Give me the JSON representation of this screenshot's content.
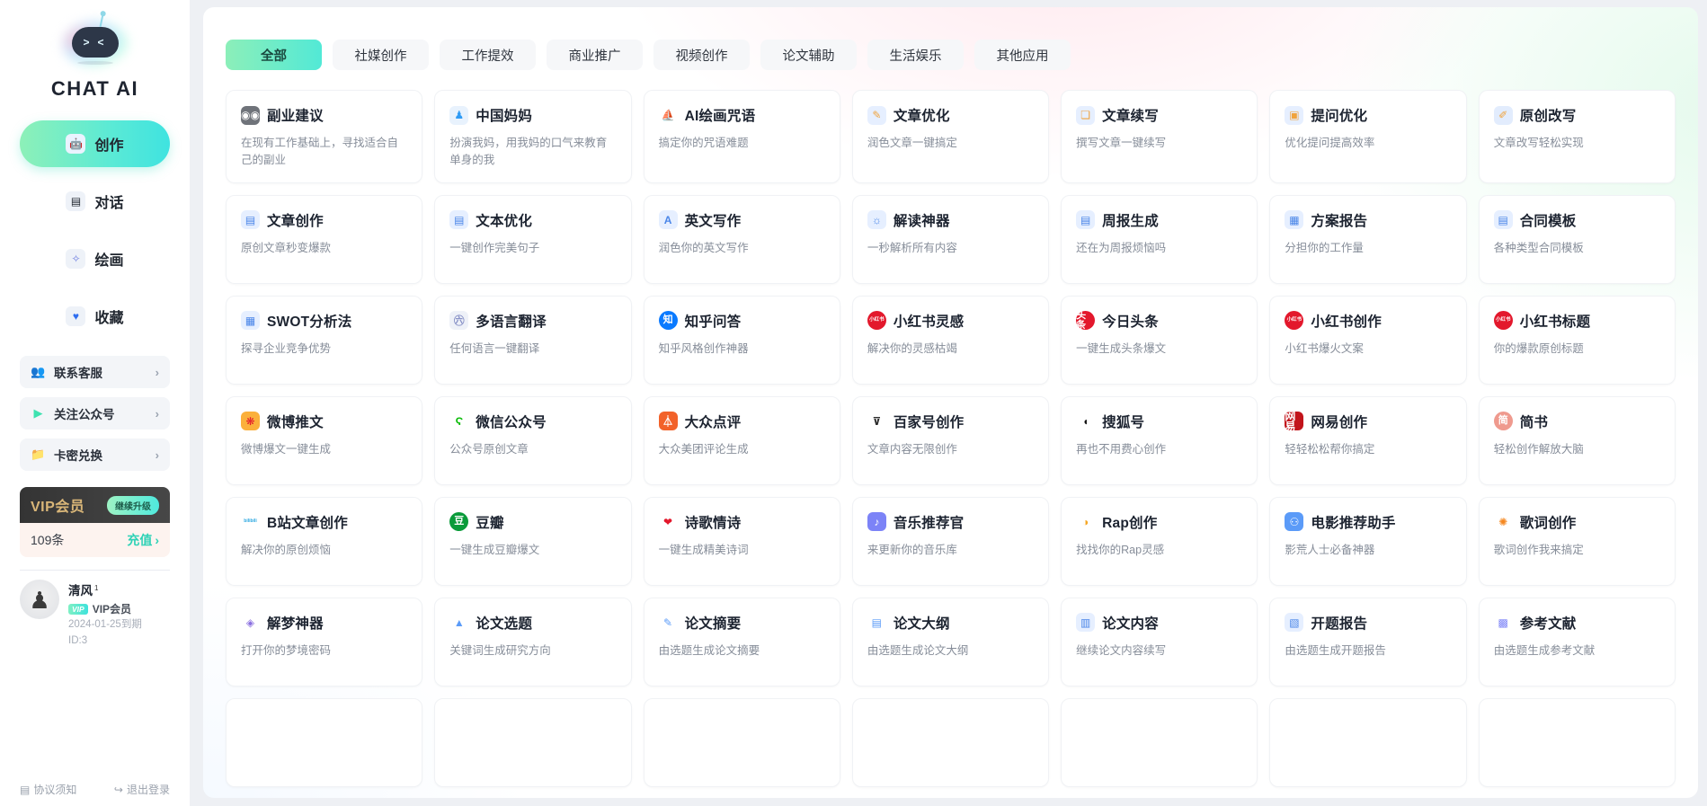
{
  "brand": {
    "name": "CHAT AI",
    "logo_icon": "robot-logo"
  },
  "sidebar": {
    "nav": [
      {
        "label": "创作",
        "icon": "robot-icon",
        "active": true
      },
      {
        "label": "对话",
        "icon": "chat-bubble-icon",
        "active": false
      },
      {
        "label": "绘画",
        "icon": "paintbrush-icon",
        "active": false
      },
      {
        "label": "收藏",
        "icon": "heart-icon",
        "active": false
      }
    ],
    "utils": [
      {
        "label": "联系客服",
        "icon": "customer-service-icon",
        "arrow": "›"
      },
      {
        "label": "关注公众号",
        "icon": "play-icon",
        "arrow": "›"
      },
      {
        "label": "卡密兑换",
        "icon": "folder-icon",
        "arrow": "›"
      }
    ],
    "vip": {
      "title": "VIP会员",
      "button": "继续升级"
    },
    "quota": {
      "count": "109条",
      "link": "充值",
      "arrow": "›"
    },
    "profile": {
      "name": "清风",
      "level": "1",
      "badge": "VIP",
      "member_label": "VIP会员",
      "expiry": "2024-01-25到期",
      "id": "ID:3",
      "avatar_icon": "user-avatar"
    },
    "footer": {
      "agreement": "协议须知",
      "agreement_icon": "document-icon",
      "logout": "退出登录",
      "logout_icon": "logout-icon"
    }
  },
  "tabs": [
    {
      "label": "全部",
      "active": true
    },
    {
      "label": "社媒创作",
      "active": false
    },
    {
      "label": "工作提效",
      "active": false
    },
    {
      "label": "商业推广",
      "active": false
    },
    {
      "label": "视频创作",
      "active": false
    },
    {
      "label": "论文辅助",
      "active": false
    },
    {
      "label": "生活娱乐",
      "active": false
    },
    {
      "label": "其他应用",
      "active": false
    }
  ],
  "cards": [
    {
      "title": "副业建议",
      "desc": "在现有工作基础上，寻找适合自己的副业",
      "icon": "panda-icon",
      "glyph": "◉◉",
      "bg": "#6f737a",
      "fg": "#ffffff"
    },
    {
      "title": "中国妈妈",
      "desc": "扮演我妈，用我妈的口气来教育单身的我",
      "icon": "person-blue-icon",
      "glyph": "♟",
      "bg": "#e8f2fd",
      "fg": "#2f9bf5"
    },
    {
      "title": "AI绘画咒语",
      "desc": "搞定你的咒语难题",
      "icon": "sailboat-icon",
      "glyph": "⛵",
      "bg": "#ffffff",
      "fg": "#5b6370"
    },
    {
      "title": "文章优化",
      "desc": "润色文章一键搞定",
      "icon": "pencil-doc-icon",
      "glyph": "✎",
      "bg": "#e6efff",
      "fg": "#f0a33c"
    },
    {
      "title": "文章续写",
      "desc": "撰写文章一键续写",
      "icon": "doc-check-icon",
      "glyph": "❏",
      "bg": "#e6efff",
      "fg": "#f0a33c"
    },
    {
      "title": "提问优化",
      "desc": "优化提问提高效率",
      "icon": "doc-blue-icon",
      "glyph": "▣",
      "bg": "#e6efff",
      "fg": "#f0a33c"
    },
    {
      "title": "原创改写",
      "desc": "文章改写轻松实现",
      "icon": "rewrite-icon",
      "glyph": "✐",
      "bg": "#e2ecfd",
      "fg": "#f0a33c"
    },
    {
      "title": "文章创作",
      "desc": "原创文章秒变爆款",
      "icon": "doc-edit-icon",
      "glyph": "▤",
      "bg": "#e6efff",
      "fg": "#4a86e8"
    },
    {
      "title": "文本优化",
      "desc": "一键创作完美句子",
      "icon": "doc-pen-icon",
      "glyph": "▤",
      "bg": "#e6efff",
      "fg": "#4a86e8"
    },
    {
      "title": "英文写作",
      "desc": "润色你的英文写作",
      "icon": "letter-a-icon",
      "glyph": "A",
      "bg": "#e6efff",
      "fg": "#4a86e8"
    },
    {
      "title": "解读神器",
      "desc": "一秒解析所有内容",
      "icon": "lamp-icon",
      "glyph": "☼",
      "bg": "#e6efff",
      "fg": "#4a86e8"
    },
    {
      "title": "周报生成",
      "desc": "还在为周报烦恼吗",
      "icon": "report-icon",
      "glyph": "▤",
      "bg": "#e6efff",
      "fg": "#4a86e8"
    },
    {
      "title": "方案报告",
      "desc": "分担你的工作量",
      "icon": "presentation-icon",
      "glyph": "▦",
      "bg": "#e6efff",
      "fg": "#4a86e8"
    },
    {
      "title": "合同模板",
      "desc": "各种类型合同模板",
      "icon": "contract-icon",
      "glyph": "▤",
      "bg": "#e6efff",
      "fg": "#4a86e8"
    },
    {
      "title": "SWOT分析法",
      "desc": "探寻企业竞争优势",
      "icon": "swot-icon",
      "glyph": "▦",
      "bg": "#e6efff",
      "fg": "#4a86e8"
    },
    {
      "title": "多语言翻译",
      "desc": "任何语言一键翻译",
      "icon": "translate-icon",
      "glyph": "㊅",
      "bg": "#eef1f8",
      "fg": "#8a93c8"
    },
    {
      "title": "知乎问答",
      "desc": "知乎风格创作神器",
      "icon": "zhihu-icon",
      "glyph": "知",
      "bg": "#0a7aff",
      "fg": "#ffffff"
    },
    {
      "title": "小红书灵感",
      "desc": "解决你的灵感枯竭",
      "icon": "xiaohongshu-icon",
      "glyph": "小红书",
      "bg": "#e3182c",
      "fg": "#ffffff"
    },
    {
      "title": "今日头条",
      "desc": "一键生成头条爆文",
      "icon": "toutiao-icon",
      "glyph": "头条",
      "bg": "#e3182c",
      "fg": "#ffffff"
    },
    {
      "title": "小红书创作",
      "desc": "小红书爆火文案",
      "icon": "xiaohongshu-icon",
      "glyph": "小红书",
      "bg": "#e3182c",
      "fg": "#ffffff"
    },
    {
      "title": "小红书标题",
      "desc": "你的爆款原创标题",
      "icon": "xiaohongshu-icon",
      "glyph": "小红书",
      "bg": "#e3182c",
      "fg": "#ffffff"
    },
    {
      "title": "微博推文",
      "desc": "微博爆文一键生成",
      "icon": "weibo-icon",
      "glyph": "❋",
      "bg": "#fbb03b",
      "fg": "#e3182c"
    },
    {
      "title": "微信公众号",
      "desc": "公众号原创文章",
      "icon": "wechat-icon",
      "glyph": "Ϛ",
      "bg": "#ffffff",
      "fg": "#09bb07"
    },
    {
      "title": "大众点评",
      "desc": "大众美团评论生成",
      "icon": "dianping-icon",
      "glyph": "⏃",
      "bg": "#f2622a",
      "fg": "#ffffff"
    },
    {
      "title": "百家号创作",
      "desc": "文章内容无限创作",
      "icon": "baijiahao-icon",
      "glyph": "⊽",
      "bg": "#ffffff",
      "fg": "#2b2b2b"
    },
    {
      "title": "搜狐号",
      "desc": "再也不用费心创作",
      "icon": "sohu-icon",
      "glyph": "◖",
      "bg": "#ffffff",
      "fg": "#111111"
    },
    {
      "title": "网易创作",
      "desc": "轻轻松松帮你搞定",
      "icon": "netease-icon",
      "glyph": "网易",
      "bg": "#c2141b",
      "fg": "#ffffff"
    },
    {
      "title": "简书",
      "desc": "轻松创作解放大脑",
      "icon": "jianshu-icon",
      "glyph": "简",
      "bg": "#ef9a8e",
      "fg": "#ffffff"
    },
    {
      "title": "B站文章创作",
      "desc": "解决你的原创烦恼",
      "icon": "bilibili-icon",
      "glyph": "bilibili",
      "bg": "#ffffff",
      "fg": "#2aa7e0"
    },
    {
      "title": "豆瓣",
      "desc": "一键生成豆瓣爆文",
      "icon": "douban-icon",
      "glyph": "豆",
      "bg": "#0a9b3a",
      "fg": "#ffffff"
    },
    {
      "title": "诗歌情诗",
      "desc": "一键生成精美诗词",
      "icon": "heart-red-icon",
      "glyph": "❤",
      "bg": "#ffffff",
      "fg": "#e3182c"
    },
    {
      "title": "音乐推荐官",
      "desc": "来更新你的音乐库",
      "icon": "music-icon",
      "glyph": "♪",
      "bg": "#7c83f7",
      "fg": "#ffffff"
    },
    {
      "title": "Rap创作",
      "desc": "找找你的Rap灵感",
      "icon": "megaphone-icon",
      "glyph": "◑",
      "bg": "#ffffff",
      "fg": "#f5a623"
    },
    {
      "title": "电影推荐助手",
      "desc": "影荒人士必备神器",
      "icon": "film-reel-icon",
      "glyph": "⚇",
      "bg": "#5b9bf8",
      "fg": "#ffffff"
    },
    {
      "title": "歌词创作",
      "desc": "歌词创作我来搞定",
      "icon": "lyrics-icon",
      "glyph": "✺",
      "bg": "#ffffff",
      "fg": "#f5871f"
    },
    {
      "title": "解梦神器",
      "desc": "打开你的梦境密码",
      "icon": "dream-icon",
      "glyph": "◈",
      "bg": "#ffffff",
      "fg": "#8a6fe0"
    },
    {
      "title": "论文选题",
      "desc": "关键词生成研究方向",
      "icon": "thesis-topic-icon",
      "glyph": "▲",
      "bg": "#ffffff",
      "fg": "#5b9bf8"
    },
    {
      "title": "论文摘要",
      "desc": "由选题生成论文摘要",
      "icon": "thesis-abstract-icon",
      "glyph": "✎",
      "bg": "#ffffff",
      "fg": "#5b9bf8"
    },
    {
      "title": "论文大纲",
      "desc": "由选题生成论文大纲",
      "icon": "thesis-outline-icon",
      "glyph": "▤",
      "bg": "#ffffff",
      "fg": "#5b9bf8"
    },
    {
      "title": "论文内容",
      "desc": "继续论文内容续写",
      "icon": "thesis-content-icon",
      "glyph": "▥",
      "bg": "#e6efff",
      "fg": "#4a86e8"
    },
    {
      "title": "开题报告",
      "desc": "由选题生成开题报告",
      "icon": "proposal-icon",
      "glyph": "▧",
      "bg": "#e6efff",
      "fg": "#4a86e8"
    },
    {
      "title": "参考文献",
      "desc": "由选题生成参考文献",
      "icon": "reference-icon",
      "glyph": "▩",
      "bg": "#ffffff",
      "fg": "#7c83f7"
    }
  ],
  "partial_row_cards": 7
}
